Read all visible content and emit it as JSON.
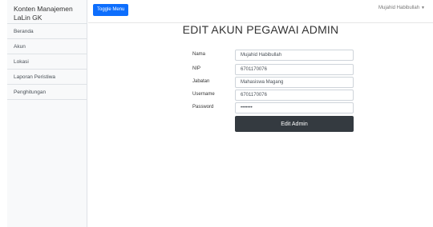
{
  "sidebar": {
    "heading": "Konten Manajemen LaLin GK",
    "items": [
      {
        "label": "Beranda"
      },
      {
        "label": "Akun"
      },
      {
        "label": "Lokasi"
      },
      {
        "label": "Laporan Peristiwa"
      },
      {
        "label": "Penghitungan"
      }
    ]
  },
  "topbar": {
    "toggle_label": "Toggle Menu",
    "user_name": "Mujahid Habibullah"
  },
  "page": {
    "title": "EDIT AKUN PEGAWAI ADMIN"
  },
  "form": {
    "fields": [
      {
        "label": "Nama",
        "value": "Mujahid Habibullah"
      },
      {
        "label": "NIP",
        "value": "6701170076"
      },
      {
        "label": "Jabatan",
        "value": "Mahasiswa Magang"
      },
      {
        "label": "Username",
        "value": "6701170076"
      },
      {
        "label": "Password",
        "value": "•••••••"
      }
    ],
    "submit_label": "Edit Admin"
  },
  "colors": {
    "primary": "#0d6efd",
    "dark": "#343a40"
  }
}
